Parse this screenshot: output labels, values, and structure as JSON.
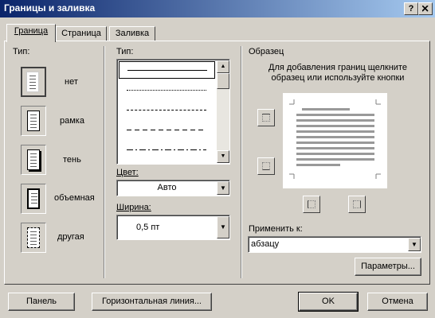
{
  "window": {
    "title": "Границы и заливка",
    "help_button": "?",
    "close_button": "X"
  },
  "tabs": [
    {
      "label": "Граница",
      "active": true
    },
    {
      "label": "Страница",
      "active": false
    },
    {
      "label": "Заливка",
      "active": false
    }
  ],
  "type_section": {
    "label": "Тип:",
    "options": [
      {
        "label": "нет",
        "icon": "border-none-icon",
        "selected": true
      },
      {
        "label": "рамка",
        "icon": "border-box-icon",
        "selected": false
      },
      {
        "label": "тень",
        "icon": "border-shadow-icon",
        "selected": false
      },
      {
        "label": "объемная",
        "icon": "border-3d-icon",
        "selected": false
      },
      {
        "label": "другая",
        "icon": "border-custom-icon",
        "selected": false
      }
    ]
  },
  "style_section": {
    "label": "Тип:",
    "line_styles": [
      "solid",
      "dotted",
      "dashed",
      "dashed-long",
      "dash-dot"
    ],
    "color_label": "Цвет:",
    "color_value": "Авто",
    "width_label": "Ширина:",
    "width_value": "0,5 пт"
  },
  "preview_section": {
    "label": "Образец",
    "hint": "Для добавления границ щелкните образец или используйте кнопки",
    "apply_label": "Применить к:",
    "apply_value": "абзацу",
    "params_button": "Параметры..."
  },
  "footer": {
    "panel_button": "Панель",
    "hline_button": "Горизонтальная линия...",
    "ok_button": "OK",
    "cancel_button": "Отмена"
  },
  "colors": {
    "face": "#d4d0c8",
    "title_start": "#0a246a",
    "title_end": "#a6caf0"
  }
}
